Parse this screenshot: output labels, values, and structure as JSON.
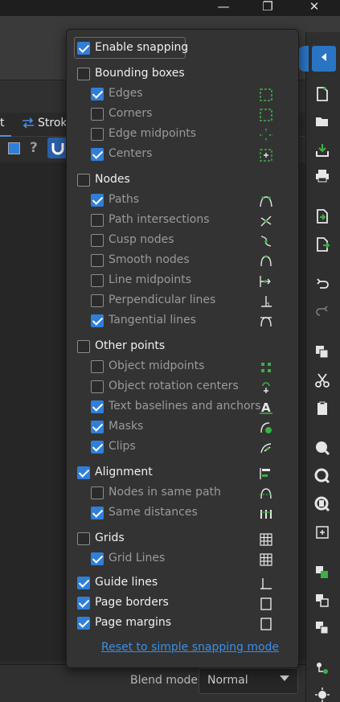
{
  "window": {
    "minimize_glyph": "—",
    "restore_glyph": "❐",
    "close_glyph": "✕"
  },
  "tabs": {
    "partial_left": "t",
    "stroke": "Strok"
  },
  "bottom": {
    "blend_label": "Blend mode:",
    "blend_value": "Normal"
  },
  "snap": {
    "enable": {
      "label": "Enable snapping",
      "checked": true
    },
    "groups": [
      {
        "label": "Bounding boxes",
        "checked": false,
        "items": [
          {
            "label": "Edges",
            "checked": true,
            "icon": "bbox-edges-icon"
          },
          {
            "label": "Corners",
            "checked": false,
            "icon": "bbox-corners-icon"
          },
          {
            "label": "Edge midpoints",
            "checked": false,
            "icon": "bbox-edge-midpoints-icon"
          },
          {
            "label": "Centers",
            "checked": true,
            "icon": "bbox-centers-icon"
          }
        ]
      },
      {
        "label": "Nodes",
        "checked": false,
        "items": [
          {
            "label": "Paths",
            "checked": true,
            "icon": "node-paths-icon"
          },
          {
            "label": "Path intersections",
            "checked": false,
            "icon": "path-intersections-icon"
          },
          {
            "label": "Cusp nodes",
            "checked": false,
            "icon": "cusp-nodes-icon"
          },
          {
            "label": "Smooth nodes",
            "checked": false,
            "icon": "smooth-nodes-icon"
          },
          {
            "label": "Line midpoints",
            "checked": false,
            "icon": "line-midpoints-icon"
          },
          {
            "label": "Perpendicular lines",
            "checked": false,
            "icon": "perpendicular-lines-icon"
          },
          {
            "label": "Tangential lines",
            "checked": true,
            "icon": "tangential-lines-icon"
          }
        ]
      },
      {
        "label": "Other points",
        "checked": false,
        "items": [
          {
            "label": "Object midpoints",
            "checked": false,
            "icon": "object-midpoints-icon"
          },
          {
            "label": "Object rotation centers",
            "checked": false,
            "icon": "rotation-centers-icon"
          },
          {
            "label": "Text baselines and anchors",
            "checked": true,
            "icon": "text-baselines-icon"
          },
          {
            "label": "Masks",
            "checked": true,
            "icon": "masks-icon"
          },
          {
            "label": "Clips",
            "checked": true,
            "icon": "clips-icon"
          }
        ]
      },
      {
        "label": "Alignment",
        "checked": true,
        "items": [
          {
            "label": "Nodes in same path",
            "checked": false,
            "icon": "nodes-same-path-icon"
          },
          {
            "label": "Same distances",
            "checked": true,
            "icon": "same-distances-icon"
          }
        ]
      },
      {
        "label": "Grids",
        "checked": false,
        "items": [
          {
            "label": "Grid Lines",
            "checked": true,
            "icon": "grid-lines-icon"
          }
        ]
      }
    ],
    "guide_lines": {
      "label": "Guide lines",
      "checked": true,
      "icon": "guide-lines-icon"
    },
    "page_borders": {
      "label": "Page borders",
      "checked": true,
      "icon": "page-borders-icon"
    },
    "page_margins": {
      "label": "Page margins",
      "checked": true,
      "icon": "page-margins-icon"
    },
    "reset_link": "Reset to simple snapping mode"
  }
}
